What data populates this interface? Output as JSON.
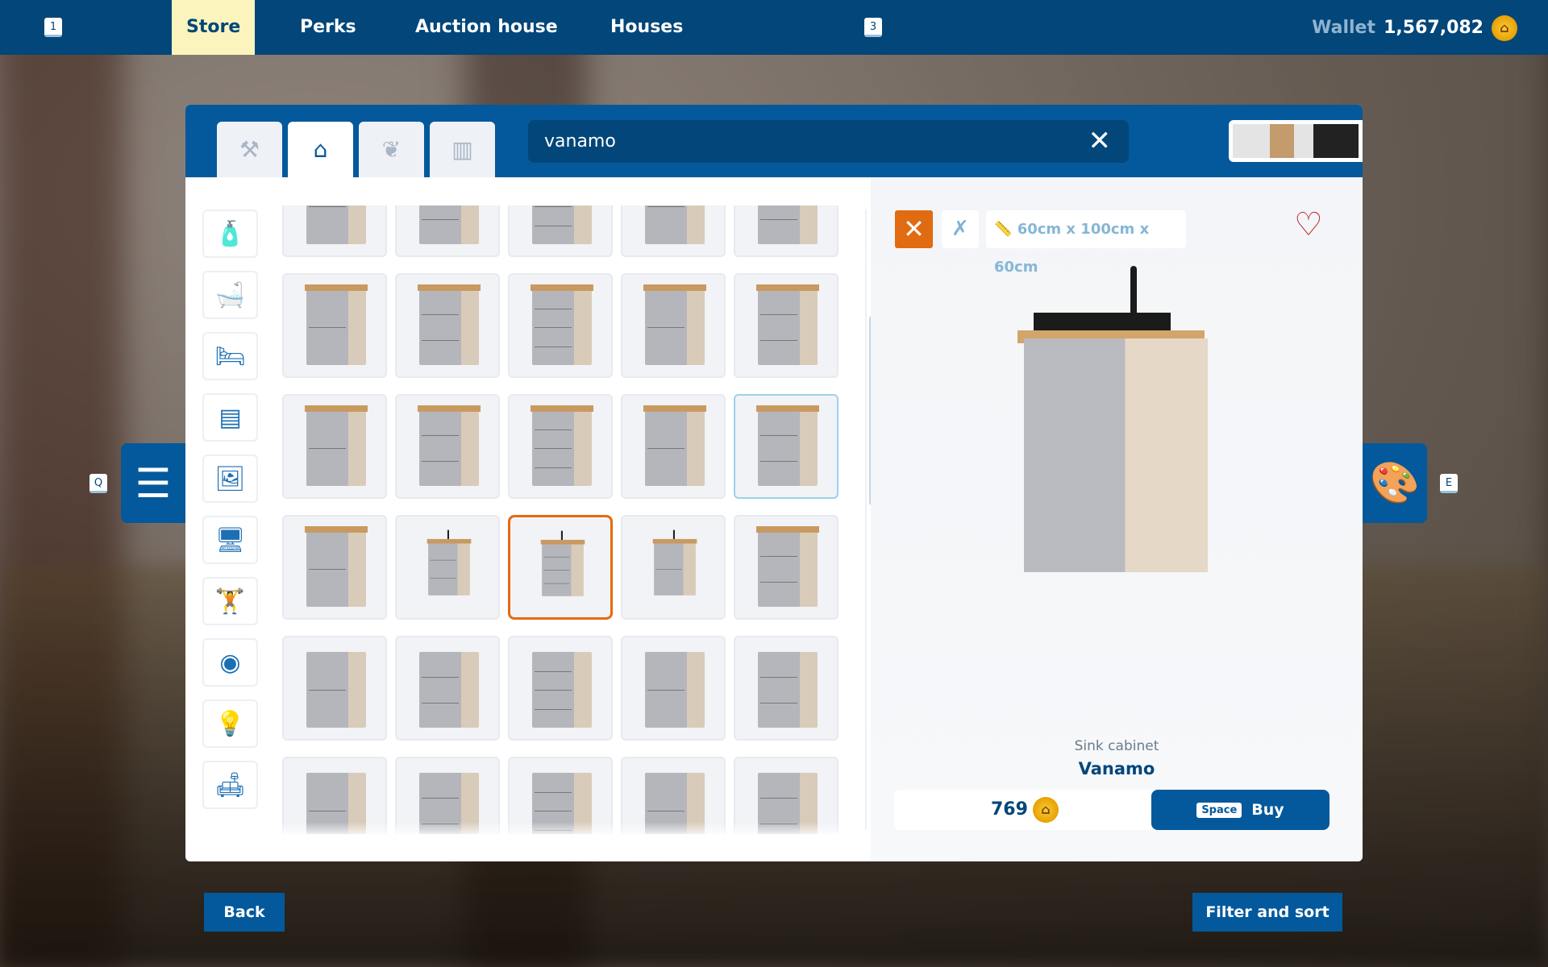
{
  "topbar": {
    "key_left": "1",
    "key_right": "3",
    "tabs": [
      {
        "label": "Store",
        "active": true
      },
      {
        "label": "Perks"
      },
      {
        "label": "Auction house"
      },
      {
        "label": "Houses"
      }
    ],
    "wallet_label": "Wallet",
    "wallet_value": "1,567,082",
    "currency_icon": "house-coin-icon"
  },
  "store": {
    "category_tabs": [
      {
        "icon": "hammer-icon"
      },
      {
        "icon": "house-icon",
        "active": true
      },
      {
        "icon": "plant-icon"
      },
      {
        "icon": "fence-icon"
      }
    ],
    "search": {
      "value": "vanamo",
      "clear_icon": "close-icon"
    },
    "swatches": [
      "#e4e4e4",
      "#c39b6c",
      "#e4e4e4",
      "#222222"
    ],
    "sidebar_categories": [
      "cleaning-icon",
      "bathtub-icon",
      "bed-icon",
      "cabinet-icon",
      "picture-icon",
      "tv-icon",
      "dumbbell-icon",
      "washing-machine-icon",
      "lamp-icon",
      "sofa-icon"
    ],
    "item_rows": 6,
    "item_cols": 5,
    "selected_item": {
      "row": 3,
      "col": 2
    },
    "hovered_item": {
      "row": 2,
      "col": 4
    },
    "detail": {
      "dimensions": "60cm x 100cm x 60cm",
      "type": "Sink cabinet",
      "name": "Vanamo",
      "price": "769",
      "buy_key": "Space",
      "buy_label": "Buy"
    }
  },
  "side_keys": {
    "left": "Q",
    "right": "E"
  },
  "footer": {
    "back": "Back",
    "filter": "Filter and sort"
  },
  "colors": {
    "primary": "#03599c",
    "dark": "#02467a",
    "accent": "#e06b10",
    "active_tab": "#fbf5bd"
  }
}
